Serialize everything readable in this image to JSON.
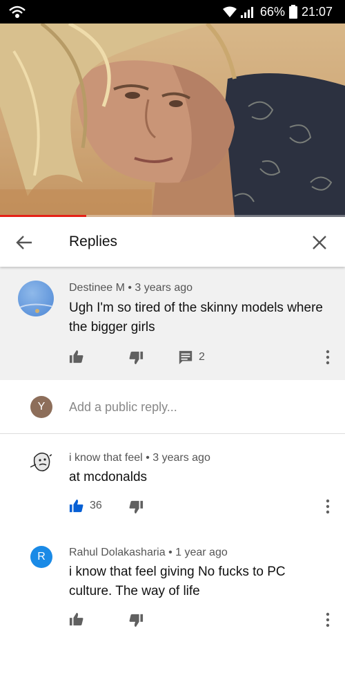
{
  "status_bar": {
    "battery": "66%",
    "time": "21:07",
    "icons": [
      "hotspot-icon",
      "wifi-icon",
      "signal-icon",
      "battery-icon"
    ]
  },
  "video": {
    "progress": 0.25,
    "progress_color": "#e62117"
  },
  "header": {
    "title": "Replies",
    "back_icon": "arrow-left-icon",
    "close_icon": "close-icon"
  },
  "top_comment": {
    "author": "Destinee M",
    "age": "3 years ago",
    "text": "Ugh I'm so tired of the skinny models where the bigger girls",
    "reply_count": "2"
  },
  "reply_box": {
    "avatar_letter": "Y",
    "placeholder": "Add a public reply..."
  },
  "replies": [
    {
      "author": "i know that feel",
      "age": "3 years ago",
      "text": "at mcdonalds",
      "likes": "36",
      "liked": true
    },
    {
      "author": "Rahul Dolakasharia",
      "age": "1 year ago",
      "text": "i know that feel giving No fucks to PC culture. The way of life",
      "avatar_letter": "R",
      "avatar_color": "#1a8ae6"
    }
  ],
  "colors": {
    "accent_blue": "#065fd4",
    "icon_grey": "#606060"
  }
}
